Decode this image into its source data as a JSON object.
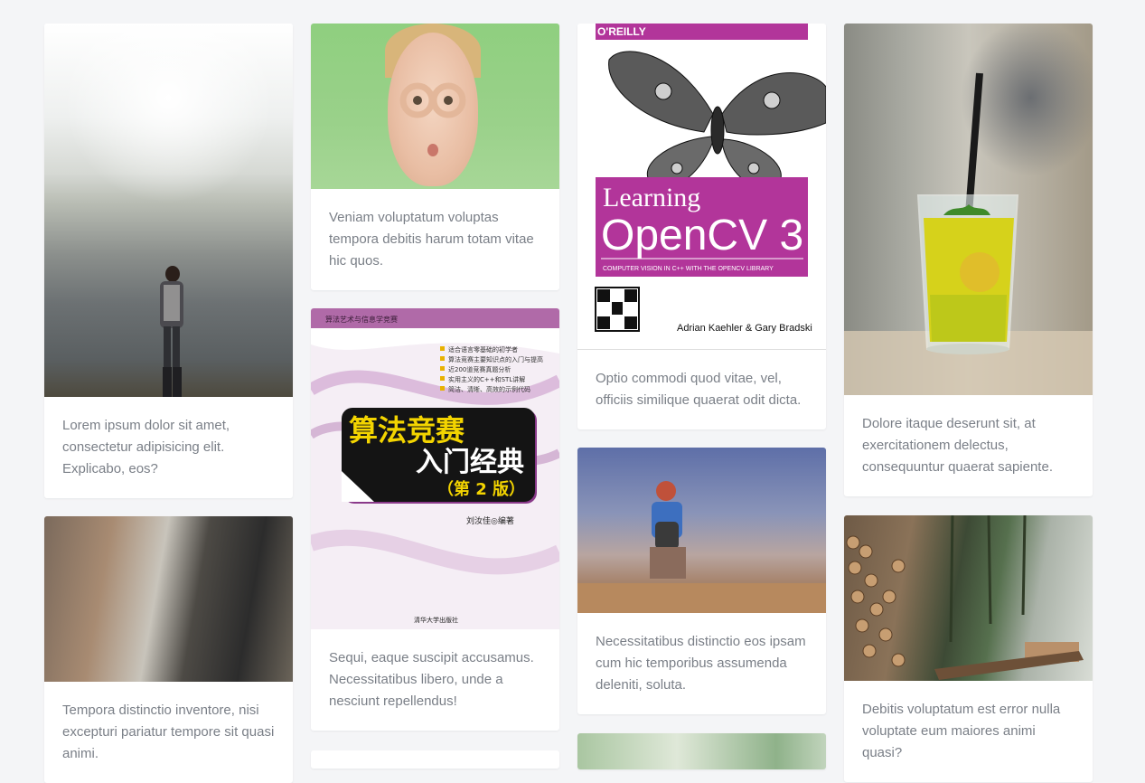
{
  "cards": [
    {
      "image": "misty-lake-person-photo",
      "text": "Lorem ipsum dolor sit amet, consectetur adipisicing elit. Explicabo, eos?"
    },
    {
      "image": "woman-hand-goggles-photo",
      "text": "Veniam voluptatum voluptas tempora debitis harum totam vitae hic quos."
    },
    {
      "image": "learning-opencv-book-cover",
      "text": "Optio commodi quod vitae, vel, officiis similique quaerat odit dicta."
    },
    {
      "image": "iced-drink-glass-photo",
      "text": "Dolore itaque deserunt sit, at exercitationem delectus, consequuntur quaerat sapiente."
    },
    {
      "image": "worker-tool-belt-photo",
      "text": "Tempora distinctio inventore, nisi excepturi pariatur tempore sit quasi animi."
    },
    {
      "image": "algorithm-contest-book-cover",
      "text": "Sequi, eaque suscipit accusamus. Necessitatibus libero, unde a nesciunt repellendus!"
    },
    {
      "image": "girl-city-view-photo",
      "text": "Necessitatibus distinctio eos ipsam cum hic temporibus assumenda deleniti, soluta."
    },
    {
      "image": "log-pile-forest-photo",
      "text": "Debitis voluptatum est error nulla voluptate eum maiores animi quasi?"
    },
    {
      "image": "blossom-branch-photo",
      "text": ""
    },
    {
      "image": "",
      "text": ""
    }
  ],
  "book_opencv": {
    "publisher": "O'REILLY",
    "title_line1": "Learning",
    "title_line2": "OpenCV 3",
    "subtitle": "COMPUTER VISION IN C++ WITH THE OPENCV LIBRARY",
    "authors": "Adrian Kaehler & Gary Bradski",
    "accent": "#b2359a"
  },
  "book_cn": {
    "series": "算法艺术与信息学竞赛",
    "bullets": [
      "适合语言零基础的初学者",
      "算法竞赛主要知识点的入门与提高",
      "近200道竞赛真题分析",
      "实用主义的C++和STL讲解",
      "简洁、清晰、高效的示例代码"
    ],
    "title_line1": "算法竞赛",
    "title_line2": "入门经典",
    "edition": "（第 2 版）",
    "author": "刘汝佳◎编著",
    "publisher": "清华大学出版社",
    "accent": "#8b3a8a"
  }
}
